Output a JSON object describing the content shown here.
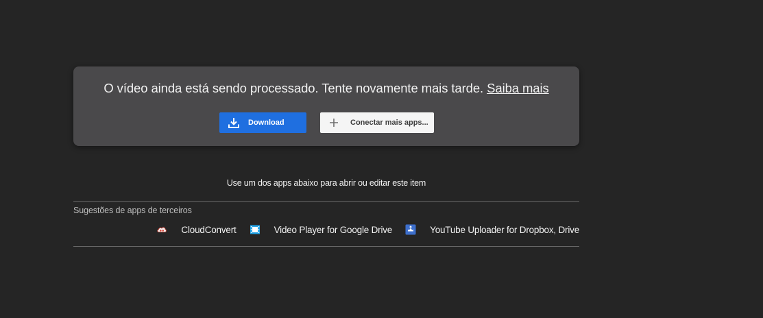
{
  "notice": {
    "message": "O vídeo ainda está sendo processado. Tente novamente mais tarde.",
    "link": "Saiba mais"
  },
  "actions": {
    "download_label": "Download",
    "connect_label": "Conectar mais apps..."
  },
  "apps": {
    "heading": "Use um dos apps abaixo para abrir ou editar este item",
    "suggestions_label": "Sugestões de apps de terceiros",
    "items": [
      {
        "name": "CloudConvert",
        "icon": "cloudconvert-icon"
      },
      {
        "name": "Video Player for Google Drive",
        "icon": "video-player-icon"
      },
      {
        "name": "YouTube Uploader for Dropbox, Drive",
        "icon": "youtube-uploader-icon"
      }
    ]
  },
  "colors": {
    "background": "#252525",
    "card": "#4a494b",
    "primary_button": "#1f6fe0",
    "secondary_button": "#f5f5f5"
  }
}
